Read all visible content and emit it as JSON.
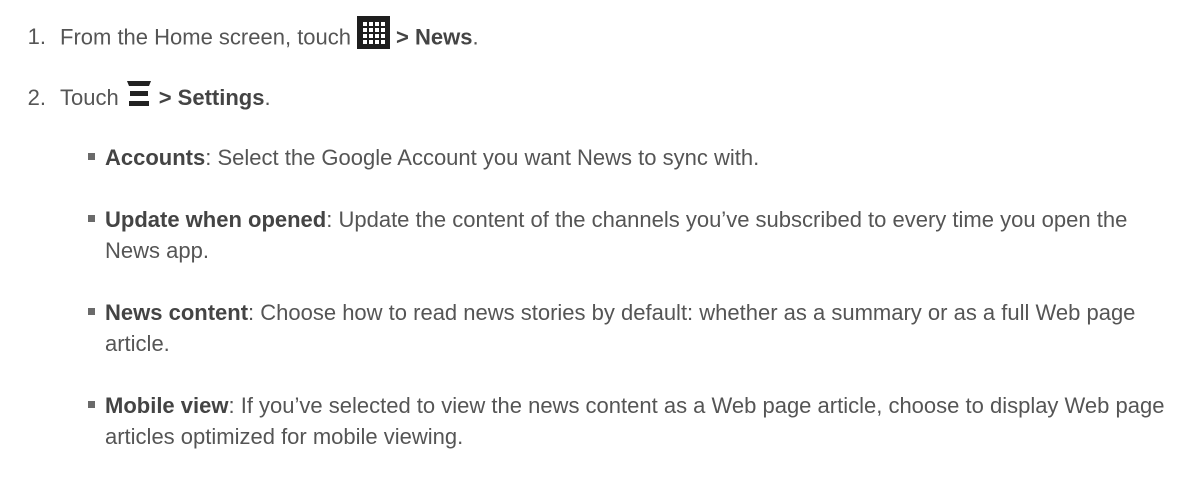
{
  "steps": [
    {
      "number": "1.",
      "text_before": "From the Home screen, touch",
      "icon": "apps-grid-icon",
      "bold": "> News",
      "text_after": "."
    },
    {
      "number": "2.",
      "text_before": "Touch",
      "icon": "menu-icon",
      "bold": "> Settings",
      "text_after": "."
    }
  ],
  "settings": [
    {
      "term": "Accounts",
      "description": ": Select the Google Account you want News to sync with."
    },
    {
      "term": "Update when opened",
      "description": ": Update the content of the channels you’ve subscribed to every time you open the News app."
    },
    {
      "term": "News content",
      "description": ": Choose how to read news stories by default: whether as a summary or as a full Web page article."
    },
    {
      "term": "Mobile view",
      "description": ": If you’ve selected to view the news content as a Web page article, choose to display Web page articles optimized for mobile viewing."
    }
  ]
}
